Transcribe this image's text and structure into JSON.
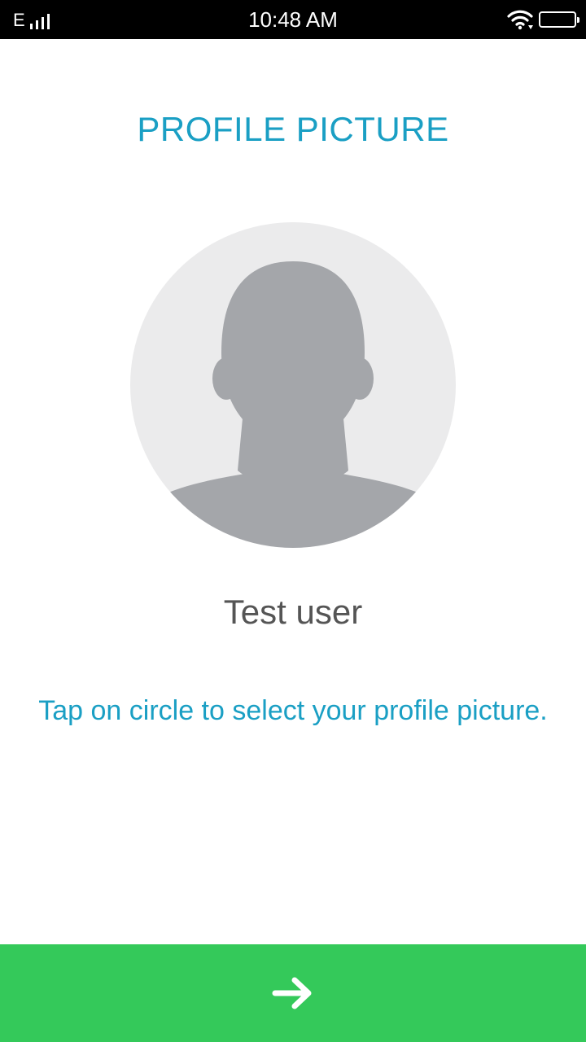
{
  "status_bar": {
    "network_type": "E",
    "time": "10:48 AM",
    "icons": [
      "signal-icon",
      "wifi-icon",
      "battery-icon"
    ]
  },
  "main": {
    "title": "PROFILE PICTURE",
    "avatar_icon": "default-avatar-silhouette",
    "user_name": "Test user",
    "hint": "Tap on circle to select your profile picture."
  },
  "footer": {
    "next_icon": "arrow-right-icon"
  },
  "colors": {
    "accent": "#1a9fc4",
    "button": "#34c95a",
    "avatar_bg": "#ebebec",
    "avatar_fg": "#a4a6aa",
    "name_text": "#555555"
  }
}
